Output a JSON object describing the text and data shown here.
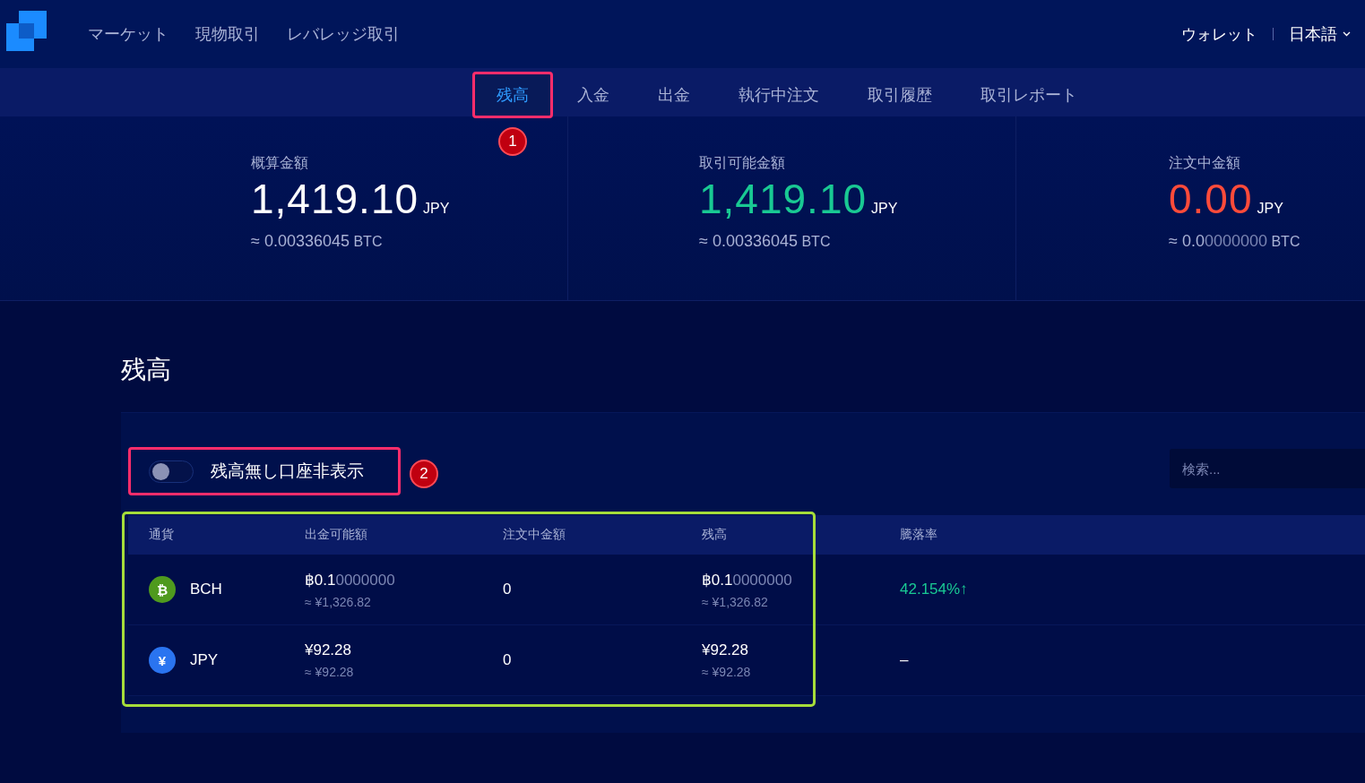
{
  "header": {
    "nav": [
      {
        "label": "マーケット"
      },
      {
        "label": "現物取引"
      },
      {
        "label": "レバレッジ取引"
      }
    ],
    "wallet": "ウォレット",
    "language": "日本語"
  },
  "tabs": [
    {
      "label": "残高",
      "selected": true,
      "highlighted": true,
      "callout": "1"
    },
    {
      "label": "入金",
      "selected": false,
      "highlighted": false
    },
    {
      "label": "出金",
      "selected": false,
      "highlighted": false
    },
    {
      "label": "執行中注文",
      "selected": false,
      "highlighted": false
    },
    {
      "label": "取引履歴",
      "selected": false,
      "highlighted": false
    },
    {
      "label": "取引レポート",
      "selected": false,
      "highlighted": false
    }
  ],
  "summary": [
    {
      "label": "概算金額",
      "amount": "1,419.10",
      "unit": "JPY",
      "kind": "neutral",
      "approx": {
        "prefix": "≈",
        "bright": "0.00336045",
        "unit": "BTC"
      }
    },
    {
      "label": "取引可能金額",
      "amount": "1,419.10",
      "unit": "JPY",
      "kind": "positive",
      "approx": {
        "prefix": "≈",
        "bright": "0.00336045",
        "unit": "BTC"
      }
    },
    {
      "label": "注文中金額",
      "amount": "0.00",
      "unit": "JPY",
      "kind": "negative",
      "approx": {
        "prefix": "≈",
        "bright": "0.0",
        "dim": "0000000",
        "unit": "BTC"
      }
    }
  ],
  "section_title": "残高",
  "filter": {
    "toggle": {
      "label": "残高無し口座非表示",
      "on": false
    },
    "highlighted": true,
    "callout": "2",
    "search": {
      "placeholder": "検索..."
    }
  },
  "table": {
    "columns": [
      {
        "label": "通貨",
        "highlighted": true
      },
      {
        "label": "出金可能額",
        "highlighted": true
      },
      {
        "label": "注文中金額",
        "highlighted": true
      },
      {
        "label": "残高",
        "highlighted": true
      },
      {
        "label": "騰落率",
        "highlighted": false
      }
    ],
    "rows": [
      {
        "coin": {
          "glyph": "₿",
          "color": "#4f9a1e",
          "code": "BCH"
        },
        "available": {
          "bright": "฿0.1",
          "dim": "0000000",
          "approx": "≈ ¥1,326.82"
        },
        "in_order": "0",
        "balance": {
          "bright": "฿0.1",
          "dim": "0000000",
          "approx": "≈ ¥1,326.82"
        },
        "change": "42.154%↑",
        "kind": "up"
      },
      {
        "coin": {
          "glyph": "¥",
          "color": "#2a74f0",
          "code": "JPY"
        },
        "available": {
          "bright": "¥92.28",
          "approx": "≈ ¥92.28"
        },
        "in_order": "0",
        "balance": {
          "bright": "¥92.28",
          "approx": "≈ ¥92.28"
        },
        "change": "–",
        "kind": "none"
      }
    ]
  }
}
